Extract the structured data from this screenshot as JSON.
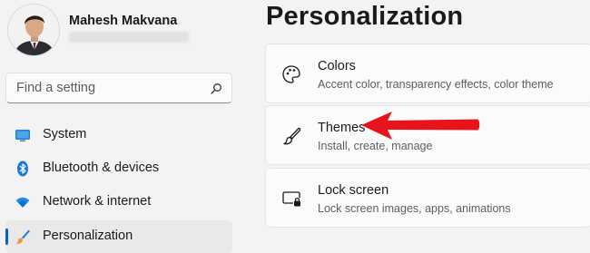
{
  "user": {
    "name": "Mahesh Makvana"
  },
  "search": {
    "placeholder": "Find a setting"
  },
  "sidebar": {
    "items": [
      {
        "label": "System",
        "icon": "monitor-icon"
      },
      {
        "label": "Bluetooth & devices",
        "icon": "bluetooth-icon"
      },
      {
        "label": "Network & internet",
        "icon": "wifi-icon"
      },
      {
        "label": "Personalization",
        "icon": "brush-icon",
        "selected": true
      }
    ]
  },
  "main": {
    "title": "Personalization",
    "cards": [
      {
        "title": "Colors",
        "subtitle": "Accent color, transparency effects, color theme",
        "icon": "palette-icon"
      },
      {
        "title": "Themes",
        "subtitle": "Install, create, manage",
        "icon": "brush-icon"
      },
      {
        "title": "Lock screen",
        "subtitle": "Lock screen images, apps, animations",
        "icon": "lock-screen-icon"
      }
    ]
  },
  "colors": {
    "accent": "#0067c0",
    "annotation_arrow": "#e8141b"
  }
}
